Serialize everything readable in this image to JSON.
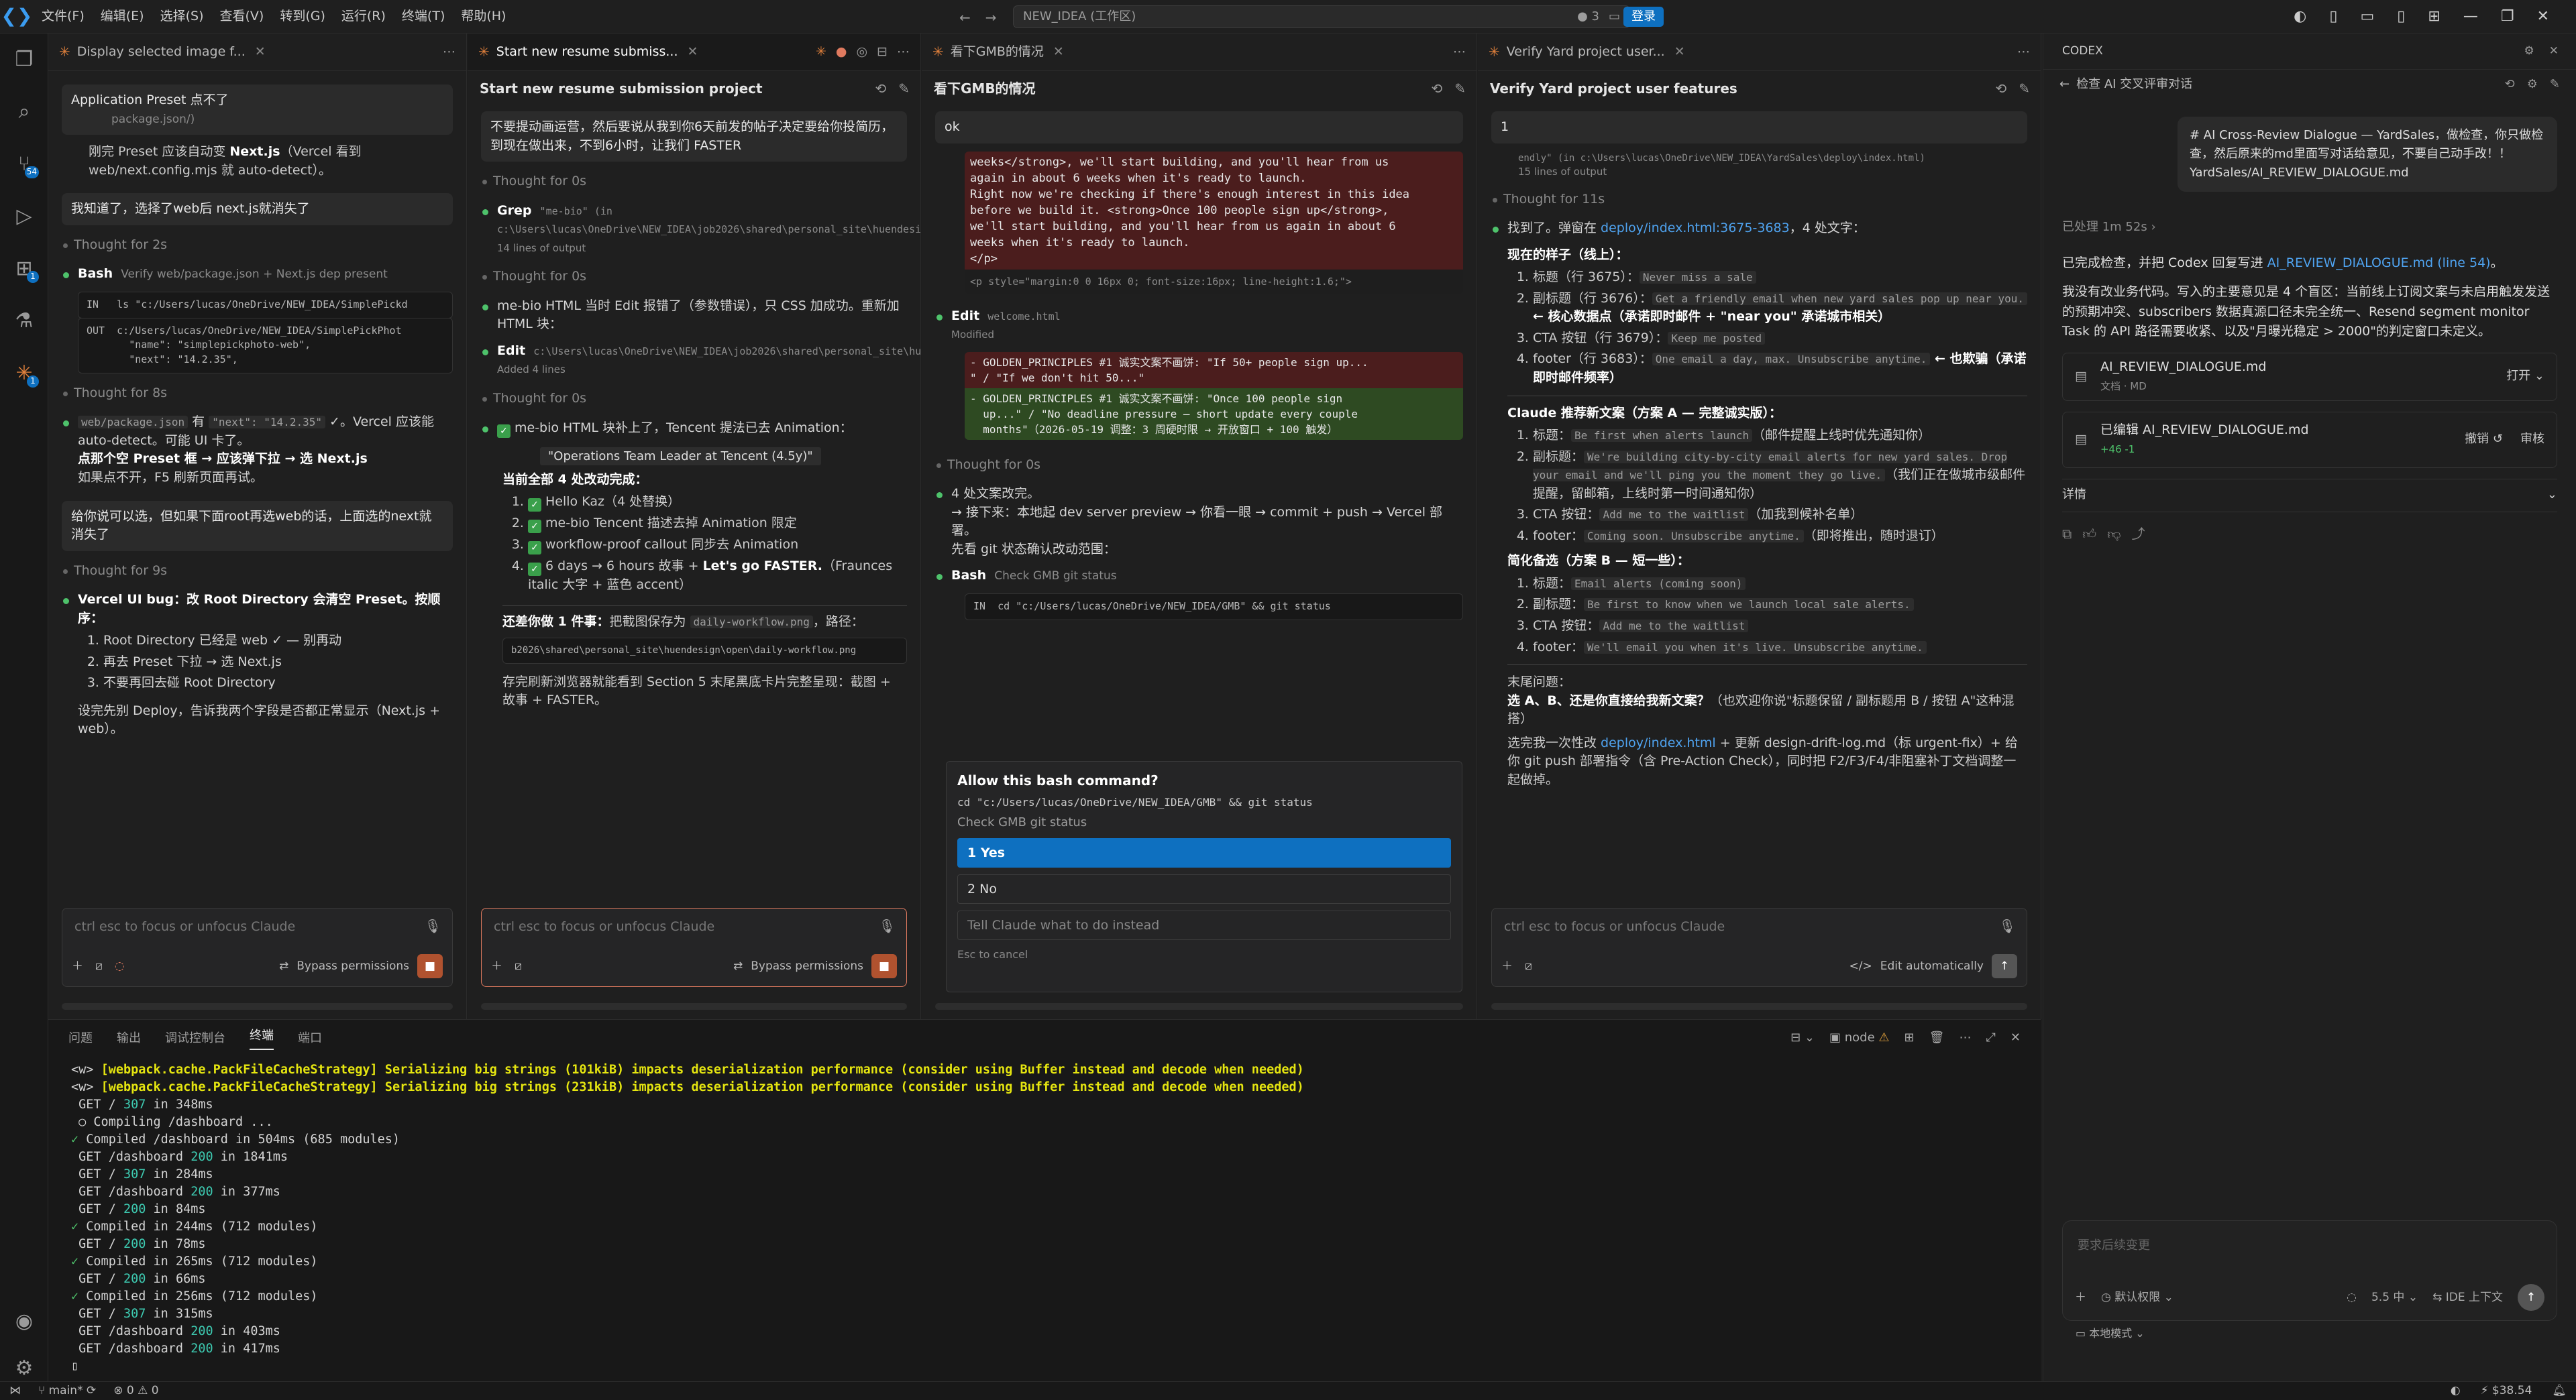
{
  "menubar": {
    "items": [
      "文件(F)",
      "编辑(E)",
      "选择(S)",
      "查看(V)",
      "转到(G)",
      "运行(R)",
      "终端(T)",
      "帮助(H)"
    ],
    "search": "NEW_IDEA (工作区)",
    "badge": "3",
    "login": "登录"
  },
  "activity": {
    "scm_badge": "54",
    "ext_badge": "1",
    "claude_badge": "1"
  },
  "p1": {
    "tab": "Display selected image f...",
    "bubble_top": "Application Preset  点不了",
    "file_hint": "package.json/)",
    "msg1a": "刚完 Preset 应该自动变 ",
    "msg1b": "Next.js",
    "msg1c": "（Vercel 看到 web/next.config.mjs 就 auto-detect）。",
    "user2": "我知道了，选择了web后 next.js就消失了",
    "t1": "Thought for 2s",
    "bash_label": "Bash",
    "bash_desc": "Verify web/package.json + Next.js dep present",
    "code_in": "IN   ls \"c:/Users/lucas/OneDrive/NEW_IDEA/SimplePickd",
    "code_out": "OUT  c:/Users/lucas/OneDrive/NEW_IDEA/SimplePickPhot\n       \"name\": \"simplepickphoto-web\",\n       \"next\": \"14.2.35\",",
    "t2": "Thought for 8s",
    "step2a": "web/package.json",
    "step2b": " 有 ",
    "step2c": "\"next\": \"14.2.35\"",
    "step2d": " ✓。Vercel 应该能 auto-detect。可能 UI 卡了。",
    "step2e": "点那个空 Preset 框 → 应该弹下拉 → 选 Next.js",
    "step2f": "如果点不开，F5 刷新页面再试。",
    "user3": "给你说可以选，但如果下面root再选web的话，上面选的next就消失了",
    "t3": "Thought for 9s",
    "step3": "Vercel UI bug：改 Root Directory 会清空 Preset。按顺序：",
    "li1": "Root Directory 已经是 web ✓ — 别再动",
    "li2": "再去 Preset 下拉 → 选 Next.js",
    "li3": "不要再回去碰 Root Directory",
    "after": "设完先别 Deploy，告诉我两个字段是否都正常显示（Next.js + web）。",
    "placeholder": "ctrl esc to focus or unfocus Claude",
    "bypass": "Bypass permissions"
  },
  "p2": {
    "tab": "Start new resume submiss...",
    "title": "Start new resume submission project",
    "bubble": "不要提动画运营，然后要说从我到你6天前发的帖子决定要给你投简历，到现在做出来，不到6小时，让我们 FASTER",
    "t1": "Thought for 0s",
    "grep_label": "Grep",
    "grep_desc": "\"me-bio\" (in c:\\Users\\lucas\\OneDrive\\NEW_IDEA\\job2026\\shared\\personal_site\\huendesign\\open\\index.html)",
    "grep_sub": "14 lines of output",
    "t2": "Thought for 0s",
    "msg1": "me-bio HTML 当时 Edit 报错了（参数错误），只 CSS 加成功。重新加 HTML 块：",
    "edit_label": "Edit",
    "edit_desc": "c:\\Users\\lucas\\OneDrive\\NEW_IDEA\\job2026\\shared\\personal_site\\huendesign\\open\\index.html",
    "edit_sub": "Added 4 lines",
    "t3": "Thought for 0s",
    "msg2": "me-bio HTML 块补上了，Tencent 提法已去 Animation：",
    "quote": "\"Operations Team Leader at Tencent (4.5y)\"",
    "done_title": "当前全部 4 处改动完成：",
    "li1": "Hello Kaz（4 处替换）",
    "li2": "me-bio Tencent 描述去掉 Animation 限定",
    "li3": "workflow-proof callout 同步去 Animation",
    "li4a": "6 days → 6 hours 故事 + ",
    "li4b": "Let's go FASTER.",
    "li4c": "（Fraunces italic 大字 + 蓝色 accent）",
    "todo_a": "还差你做 1 件事：",
    "todo_b": "把截图保存为 ",
    "todo_file": "daily-workflow.png",
    "todo_c": "，路径：",
    "path": "b2026\\shared\\personal_site\\huendesign\\open\\daily-workflow.png",
    "final": "存完刷新浏览器就能看到 Section 5 末尾黑底卡片完整呈现：截图 + 故事 + FASTER。",
    "placeholder": "ctrl esc to focus or unfocus Claude",
    "bypass": "Bypass permissions"
  },
  "p3": {
    "tab": "看下GMB的情况",
    "title": "看下GMB的情况",
    "ok": "ok",
    "code1": "weeks</strong>, we'll start building, and you'll hear from us\nagain in about 6 weeks when it's ready to launch.\nRight now we're checking if there's enough interest in this idea\nbefore we build it. <strong>Once 100 people sign up</strong>,\nwe'll start building, and you'll hear from us again in about 6\nweeks when it's ready to launch.\n</p>",
    "code1b": "<p style=\"margin:0 0 16px 0; font-size:16px; line-height:1.6;\">",
    "edit_label": "Edit",
    "edit_desc": "welcome.html",
    "edit_sub": "Modified",
    "diff1": "- GOLDEN_PRINCIPLES #1 诚实文案不画饼: \"If 50+ people sign up...\n\" / \"If we don't hit 50...\"",
    "diff2": "- GOLDEN_PRINCIPLES #1 诚实文案不画饼: \"Once 100 people sign\n  up...\" / \"No deadline pressure — short update every couple\n  months\"（2026-05-19 调整：3 周硬时限 → 开放窗口 + 100 触发）",
    "t1": "Thought for 0s",
    "msg": "4 处文案改完。\n→ 接下来：本地起 dev server preview → 你看一眼 → commit + push → Vercel 部署。\n先看 git 状态确认改动范围：",
    "bash_label": "Bash",
    "bash_desc": "Check GMB git status",
    "bash_code": "IN  cd \"c:/Users/lucas/OneDrive/NEW_IDEA/GMB\" && git status",
    "dlg_title": "Allow this bash command?",
    "dlg_cmd": "cd \"c:/Users/lucas/OneDrive/NEW_IDEA/GMB\" && git status",
    "dlg_desc": "Check GMB git status",
    "opt1": "1  Yes",
    "opt2": "2  No",
    "opt3": "Tell Claude what to do instead",
    "esc": "Esc to cancel"
  },
  "p4": {
    "tab": "Verify Yard project user...",
    "title": "Verify Yard project user features",
    "num": "1",
    "path": "endly\" (in c:\\Users\\lucas\\OneDrive\\NEW_IDEA\\YardSales\\deploy\\index.html)",
    "sub": "15 lines of output",
    "t1": "Thought for 11s",
    "found_a": "找到了。弹窗在 ",
    "found_link": "deploy/index.html:3675-3683",
    "found_b": "，4 处文字：",
    "cur_title": "现在的样子（线上）：",
    "c1a": "标题（行 3675）：",
    "c1b": "Never miss a sale",
    "c2a": "副标题（行 3676）：",
    "c2b": "Get a friendly email when new yard sales pop up near you.",
    "c2c": " ← 核心数据点（承诺即时邮件 + \"near you\" 承诺城市相关）",
    "c3a": "CTA 按钮（行 3679）：",
    "c3b": "Keep me posted",
    "c4a": "footer（行 3683）：",
    "c4b": "One email a day, max. Unsubscribe anytime.",
    "c4c": " ← 也欺骗（承诺即时邮件频率）",
    "rec_title": "Claude 推荐新文案（方案 A — 完整诚实版）：",
    "r1a": "标题：",
    "r1b": "Be first when alerts launch",
    "r1c": "（邮件提醒上线时优先通知你）",
    "r2a": "副标题：",
    "r2b": "We're building city-by-city email alerts for new yard sales. Drop your email and we'll ping you the moment they go live.",
    "r2c": "（我们正在做城市级邮件提醒，留邮箱，上线时第一时间通知你）",
    "r3a": "CTA 按钮：",
    "r3b": "Add me to the waitlist",
    "r3c": "（加我到候补名单）",
    "r4a": "footer：",
    "r4b": "Coming soon. Unsubscribe anytime.",
    "r4c": "（即将推出，随时退订）",
    "alt_title": "简化备选（方案 B — 短一些）：",
    "a1a": "标题：",
    "a1b": "Email alerts (coming soon)",
    "a2a": "副标题：",
    "a2b": "Be first to know when we launch local sale alerts.",
    "a3a": "CTA 按钮：",
    "a3b": "Add me to the waitlist",
    "a4a": "footer：",
    "a4b": "We'll email you when it's live. Unsubscribe anytime.",
    "q_title": "末尾问题：",
    "q1": "选 A、B、还是你直接给我新文案？",
    "q2": "（也欢迎你说\"标题保留 / 副标题用 B / 按钮 A\"这种混搭）",
    "q3a": "选完我一次性改 ",
    "q3link": "deploy/index.html",
    "q3b": " + 更新 design-drift-log.md（标 urgent-fix）+ 给你 git push 部署指令（含 Pre-Action Check），同时把 F2/F3/F4/非阻塞补丁文档调整一起做掉。",
    "placeholder": "ctrl esc to focus or unfocus Claude",
    "auto": "Edit automatically"
  },
  "terminal": {
    "tabs": [
      "问题",
      "输出",
      "调试控制台",
      "终端",
      "端口"
    ],
    "active": "终端",
    "shell": "node",
    "lines": [
      {
        "t": "warn",
        "pre": "<w> ",
        "text": "[webpack.cache.PackFileCacheStrategy] Serializing big strings (101kiB) impacts deserialization performance (consider using Buffer instead and decode when needed)"
      },
      {
        "t": "warn",
        "pre": "<w> ",
        "text": "[webpack.cache.PackFileCacheStrategy] Serializing big strings (231kiB) impacts deserialization performance (consider using Buffer instead and decode when needed)"
      },
      {
        "t": "get",
        "path": "GET / ",
        "code": "307",
        "rest": " in 348ms"
      },
      {
        "t": "plain",
        "text": " ○ Compiling /dashboard ..."
      },
      {
        "t": "ok",
        "text": " Compiled /dashboard in 504ms (685 modules)"
      },
      {
        "t": "get",
        "path": "GET /dashboard ",
        "code": "200",
        "rest": " in 1841ms"
      },
      {
        "t": "get",
        "path": "GET / ",
        "code": "307",
        "rest": " in 284ms"
      },
      {
        "t": "get",
        "path": "GET /dashboard ",
        "code": "200",
        "rest": " in 377ms"
      },
      {
        "t": "get",
        "path": "GET / ",
        "code": "200",
        "rest": " in 84ms"
      },
      {
        "t": "ok",
        "text": " Compiled in 244ms (712 modules)"
      },
      {
        "t": "get",
        "path": "GET / ",
        "code": "200",
        "rest": " in 78ms"
      },
      {
        "t": "ok",
        "text": " Compiled in 265ms (712 modules)"
      },
      {
        "t": "get",
        "path": "GET / ",
        "code": "200",
        "rest": " in 66ms"
      },
      {
        "t": "ok",
        "text": " Compiled in 256ms (712 modules)"
      },
      {
        "t": "get",
        "path": "GET / ",
        "code": "307",
        "rest": " in 315ms"
      },
      {
        "t": "get",
        "path": "GET /dashboard ",
        "code": "200",
        "rest": " in 403ms"
      },
      {
        "t": "get",
        "path": "GET /dashboard ",
        "code": "200",
        "rest": " in 417ms"
      }
    ]
  },
  "codex": {
    "title": "CODEX",
    "back": "检查 AI 交叉评审对话",
    "user_msg": "# AI Cross-Review Dialogue — YardSales，做检查，你只做检查，然后原来的md里面写对话给意见，不要自己动手改！！YardSales/AI_REVIEW_DIALOGUE.md",
    "processed": "已处理 1m 52s",
    "p1a": "已完成检查，并把 Codex 回复写进 ",
    "p1link": "AI_REVIEW_DIALOGUE.md (line 54)",
    "p1b": "。",
    "p2": "我没有改业务代码。写入的主要意见是 4 个盲区：当前线上订阅文案与未启用触发发送的预期冲突、subscribers 数据真源口径未完全统一、Resend segment monitor Task 的 API 路径需要收紧、以及\"月曝光稳定 > 2000\"的判定窗口未定义。",
    "f1_name": "AI_REVIEW_DIALOGUE.md",
    "f1_type": "文档 · MD",
    "f1_open": "打开",
    "f2_name": "已编辑 AI_REVIEW_DIALOGUE.md",
    "f2_diff": "+46 -1",
    "f2_undo": "撤销",
    "f2_review": "审核",
    "details": "详情",
    "followup": "要求后续变更",
    "perm": "默认权限",
    "model": "5.5 中",
    "ide": "IDE 上下文",
    "local": "本地模式"
  },
  "statusbar": {
    "branch": "main*",
    "problems": "⊗ 0 ⚠ 0",
    "cost": "$38.54"
  }
}
